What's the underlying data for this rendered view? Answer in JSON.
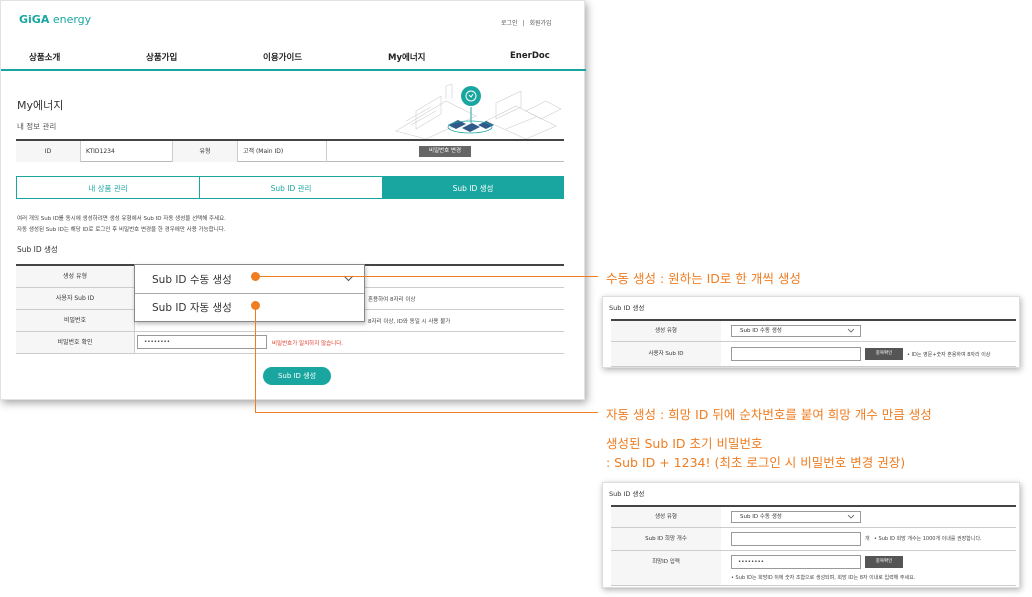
{
  "header": {
    "logo_giga": "GiGA",
    "logo_energy": " energy",
    "login": "로그인",
    "sep": "|",
    "signup": "회원가입"
  },
  "nav": [
    "상품소개",
    "상품가입",
    "이용가이드",
    "My에너지",
    "EnerDoc"
  ],
  "page": {
    "title": "My에너지",
    "subtitle": "내 정보 관리"
  },
  "info": {
    "id_label": "ID",
    "id_value": "KTID1234",
    "type_label": "유형",
    "type_value": "고객 (Main ID)",
    "pw_change": "비밀번호 변경"
  },
  "tabs": [
    "내 상품 관리",
    "Sub ID 관리",
    "Sub ID 생성"
  ],
  "desc": [
    "여러 개의 Sub ID를 동시에 생성하려면 생성 유형에서  Sub ID 자동 생성을 선택해 주세요.",
    "자동 생성된 Sub ID는 해당 ID로 로그인 후 비밀번호 변경을 한 경우에만 사용 가능합니다."
  ],
  "form": {
    "section": "Sub ID 생성",
    "labels": [
      "생성 유형",
      "사용자 Sub ID",
      "비밀번호",
      "비밀번호 확인"
    ],
    "note_id": "혼용하여 8자리 이상",
    "note_pw": "8자리 이상, ID와 동일 시 사용 불가",
    "pw_confirm_value": "••••••••",
    "error": "비밀번호가 일치하지 않습니다.",
    "submit": "Sub ID 생성"
  },
  "dropdown": {
    "options": [
      "Sub ID 수동 생성",
      "Sub ID 자동 생성"
    ],
    "chevron": "chevron-down-icon"
  },
  "annotations": {
    "manual": "수동 생성 : 원하는 ID로 한 개씩 생성",
    "auto": "자동 생성 : 희망  ID 뒤에 순차번호를 붙여 희망 개수 만큼 생성",
    "init_pw_1": "생성된 Sub ID 초기 비밀번호",
    "init_pw_2": ": Sub ID + 1234! (최초 로그인 시 비밀번호 변경 권장)"
  },
  "mini1": {
    "title": "Sub ID 생성",
    "type_label": "생성 유형",
    "type_value": "Sub ID 수동 생성",
    "user_label": "사용자 Sub ID",
    "check_btn": "중복확인",
    "note": "• ID는 영문+숫자 혼용하여 8자리 이상"
  },
  "mini2": {
    "title": "Sub ID 생성",
    "type_label": "생성 유형",
    "type_value": "Sub ID 수동 생성",
    "count_label": "Sub ID 희망 개수",
    "count_unit": "개",
    "count_note": "• Sub ID 희망 개수는 1000개 이내를 권장합니다.",
    "hope_label": "희망ID 입력",
    "hope_value": "••••••••",
    "check_btn": "중복확인",
    "hope_note": "• Sub ID는 희망ID 뒤에 숫자 조합으로 생성되며, 희망 ID는 8자 이내로 입력해 주세요."
  },
  "colors": {
    "brand": "#19a6a0",
    "accent": "#ef7d22"
  }
}
